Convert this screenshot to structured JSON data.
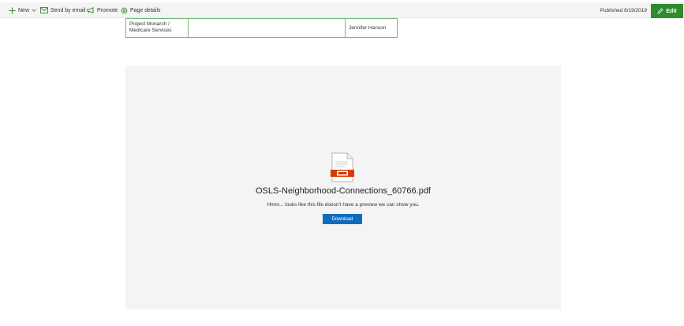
{
  "commandbar": {
    "new_label": "New",
    "send_email_label": "Send by email",
    "promote_label": "Promote",
    "page_details_label": "Page details",
    "published_text": "Published 8/19/2019",
    "edit_label": "Edit",
    "accent_color": "#2e8b2e"
  },
  "table": {
    "row": [
      "Project Monarch / Medicare Services",
      "",
      "Jennifer Hanson"
    ]
  },
  "preview": {
    "file_name": "OSLS-Neighborhood-Connections_60766.pdf",
    "message": "Hmm... looks like this file doesn't have a preview we can show you.",
    "download_label": "Download",
    "icon": "pdf-file-icon",
    "button_color": "#0f6cbd"
  }
}
